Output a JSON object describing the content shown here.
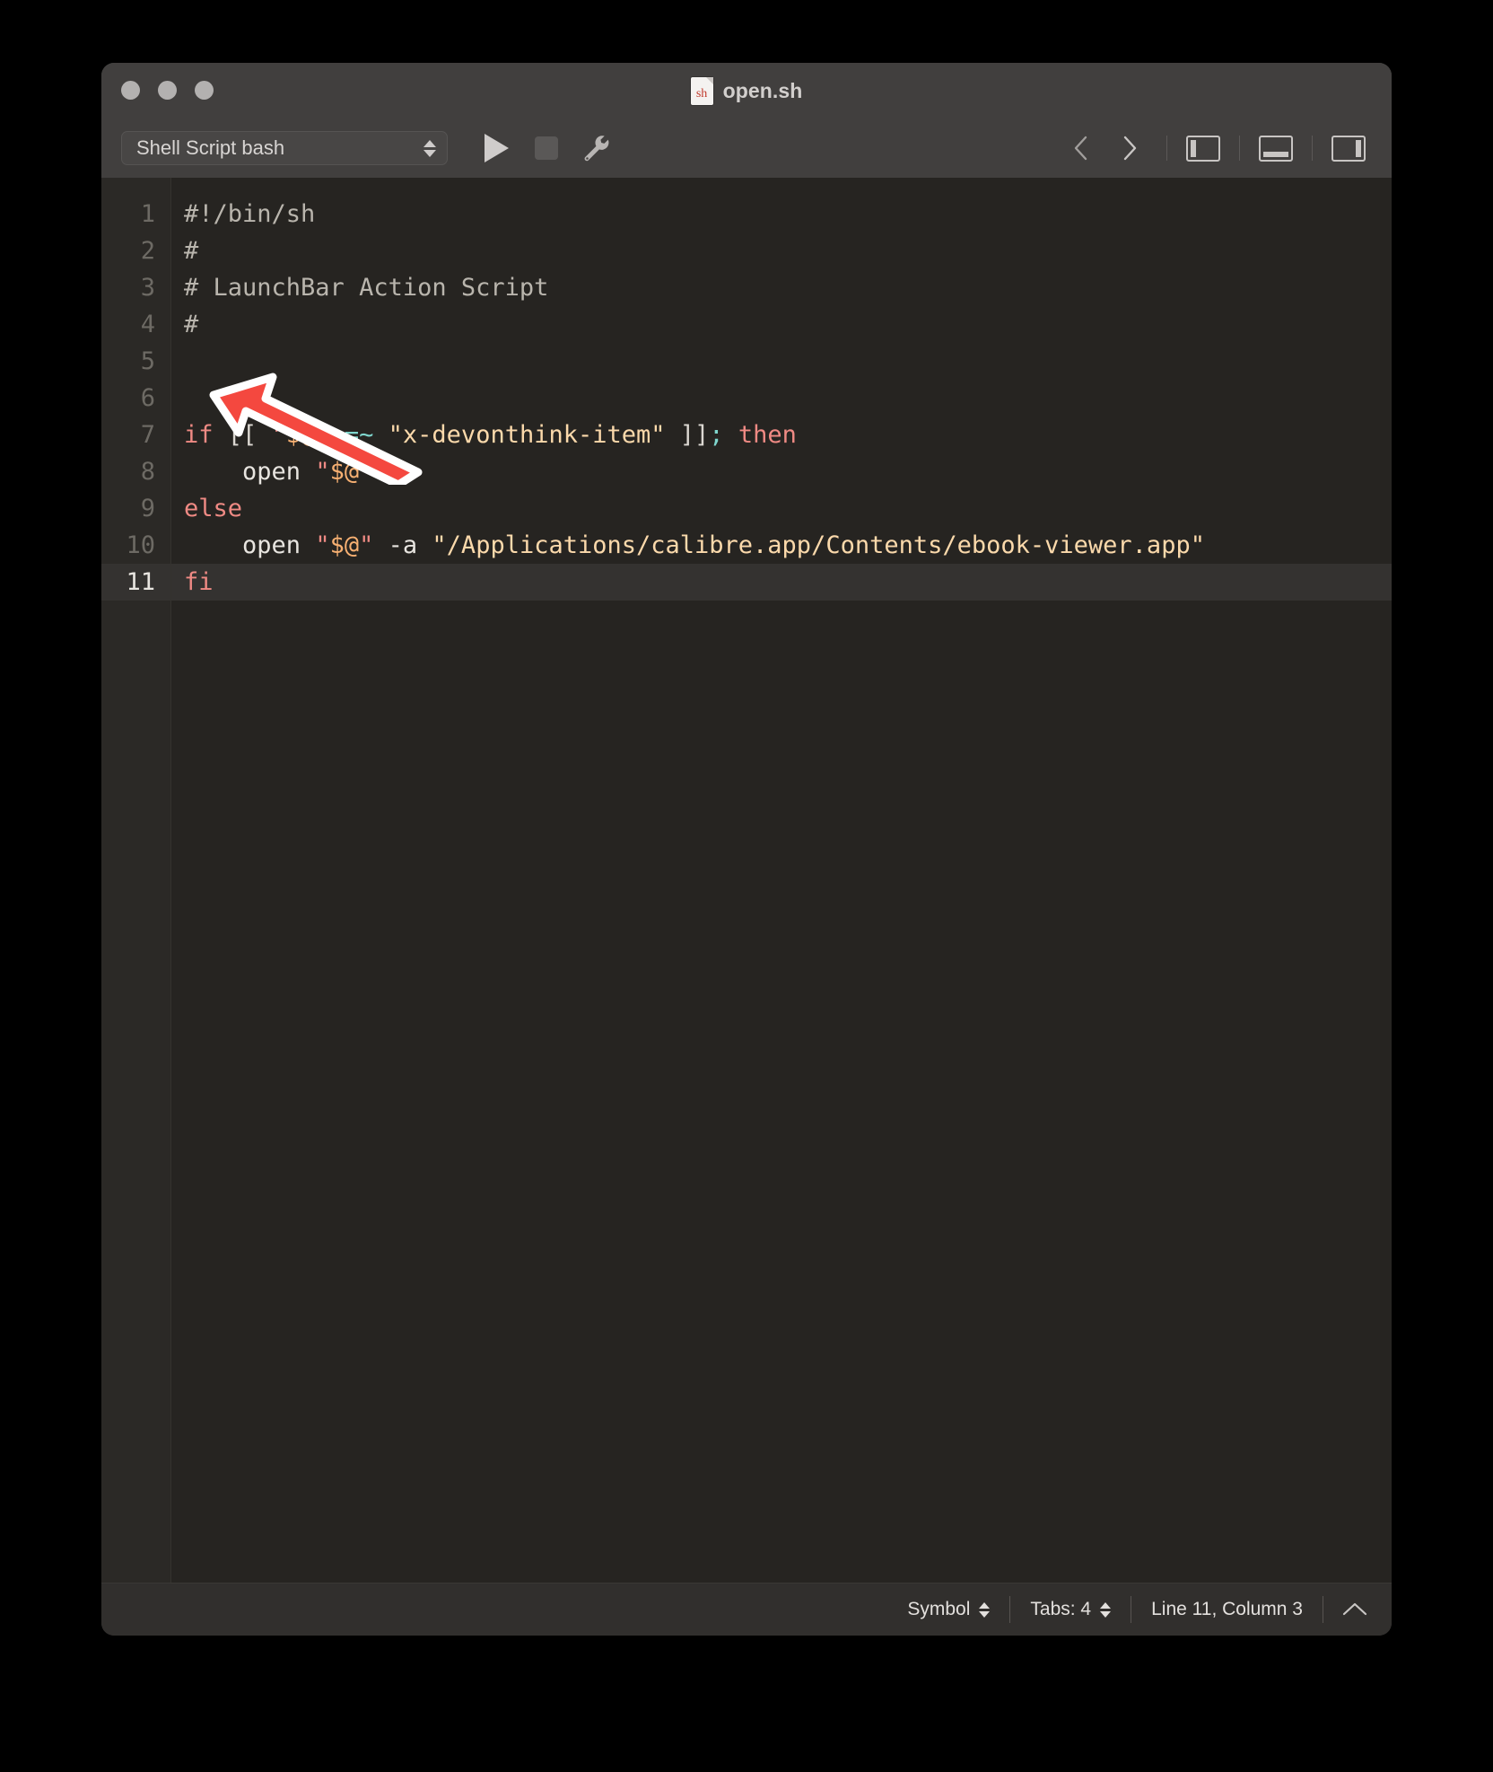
{
  "window": {
    "title": "open.sh",
    "file_icon_label": "sh",
    "traffic_lights": [
      "close",
      "minimize",
      "zoom"
    ]
  },
  "toolbar": {
    "syntax_mode": "Shell Script bash",
    "run_label": "Run",
    "stop_label": "Stop",
    "build_label": "Build Tools",
    "nav_back_label": "Back",
    "nav_forward_label": "Forward",
    "left_panel_label": "Toggle Sidebar",
    "bottom_panel_label": "Toggle Console",
    "right_panel_label": "Toggle Inspector"
  },
  "editor": {
    "current_line": 11,
    "lines": [
      {
        "n": "1",
        "tokens": [
          {
            "t": "#!/bin/sh",
            "c": "t-cmt"
          }
        ]
      },
      {
        "n": "2",
        "tokens": [
          {
            "t": "#",
            "c": "t-cmt"
          }
        ]
      },
      {
        "n": "3",
        "tokens": [
          {
            "t": "# LaunchBar Action Script",
            "c": "t-cmt"
          }
        ]
      },
      {
        "n": "4",
        "tokens": [
          {
            "t": "#",
            "c": "t-cmt"
          }
        ]
      },
      {
        "n": "5",
        "tokens": [
          {
            "t": "",
            "c": "t-pun"
          }
        ]
      },
      {
        "n": "6",
        "tokens": [
          {
            "t": "",
            "c": "t-pun"
          }
        ]
      },
      {
        "n": "7",
        "tokens": [
          {
            "t": "if",
            "c": "t-kw"
          },
          {
            "t": " ",
            "c": "t-pun"
          },
          {
            "t": "[[",
            "c": "t-pun"
          },
          {
            "t": " ",
            "c": "t-pun"
          },
          {
            "t": "\"",
            "c": "t-kw"
          },
          {
            "t": "$@",
            "c": "t-var"
          },
          {
            "t": "\"",
            "c": "t-kw"
          },
          {
            "t": " ",
            "c": "t-pun"
          },
          {
            "t": "=~",
            "c": "t-op"
          },
          {
            "t": " ",
            "c": "t-pun"
          },
          {
            "t": "\"x-devonthink-item\"",
            "c": "t-str"
          },
          {
            "t": " ",
            "c": "t-pun"
          },
          {
            "t": "]]",
            "c": "t-pun"
          },
          {
            "t": ";",
            "c": "t-op"
          },
          {
            "t": " ",
            "c": "t-pun"
          },
          {
            "t": "then",
            "c": "t-kw"
          }
        ]
      },
      {
        "n": "8",
        "tokens": [
          {
            "t": "    ",
            "c": "t-pun"
          },
          {
            "t": "open",
            "c": "t-fn"
          },
          {
            "t": " ",
            "c": "t-pun"
          },
          {
            "t": "\"",
            "c": "t-kw"
          },
          {
            "t": "$@",
            "c": "t-var"
          },
          {
            "t": "\"",
            "c": "t-kw"
          }
        ]
      },
      {
        "n": "9",
        "tokens": [
          {
            "t": "else",
            "c": "t-kw"
          }
        ]
      },
      {
        "n": "10",
        "tokens": [
          {
            "t": "    ",
            "c": "t-pun"
          },
          {
            "t": "open",
            "c": "t-fn"
          },
          {
            "t": " ",
            "c": "t-pun"
          },
          {
            "t": "\"",
            "c": "t-kw"
          },
          {
            "t": "$@",
            "c": "t-var"
          },
          {
            "t": "\"",
            "c": "t-kw"
          },
          {
            "t": " ",
            "c": "t-pun"
          },
          {
            "t": "-a",
            "c": "t-fn"
          },
          {
            "t": " ",
            "c": "t-pun"
          },
          {
            "t": "\"/Applications/calibre.app/Contents/ebook-viewer.app\"",
            "c": "t-str"
          }
        ]
      },
      {
        "n": "11",
        "tokens": [
          {
            "t": "fi",
            "c": "t-kw"
          }
        ]
      }
    ]
  },
  "statusbar": {
    "symbol_label": "Symbol",
    "tabs_label": "Tabs: 4",
    "position_label": "Line 11, Column 3",
    "expand_label": "Show Console"
  },
  "annotation": {
    "arrow_color": "#f4483f",
    "arrow_outline": "#ffffff"
  },
  "colors": {
    "window_chrome": "#413f3e",
    "editor_bg": "#262421",
    "gutter_bg": "#2b2926",
    "current_line_bg": "#343230",
    "statusbar_bg": "#312f2d",
    "keyword": "#ef8a84",
    "string": "#fbd9ab",
    "variable": "#f7b072",
    "operator": "#7fd6cd",
    "comment": "#b9b5ad",
    "text": "#dcd8d2"
  }
}
